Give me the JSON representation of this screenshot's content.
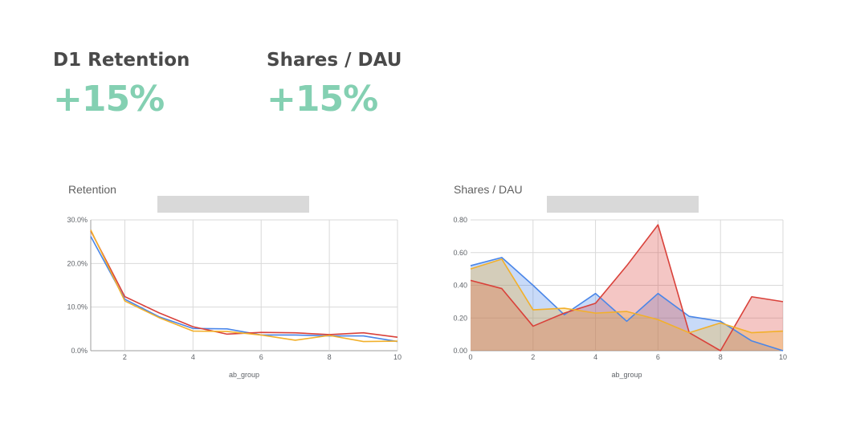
{
  "kpis": [
    {
      "label": "D1 Retention",
      "value": "+15%"
    },
    {
      "label": "Shares / DAU",
      "value": "+15%"
    }
  ],
  "colors": {
    "kpi_value": "#84d0b2",
    "blue": "#4a86e8",
    "red": "#d9413a",
    "yellow": "#f2b02b",
    "grid": "#d9d9d9",
    "legend_placeholder": "#d9d9d9"
  },
  "chart_data": [
    {
      "type": "line",
      "title": "Retention",
      "xlabel": "ab_group",
      "ylabel": "",
      "xlim": [
        1,
        10
      ],
      "ylim": [
        0,
        0.3
      ],
      "x_ticks": [
        "2",
        "4",
        "6",
        "8",
        "10"
      ],
      "x_tick_values": [
        2,
        4,
        6,
        8,
        10
      ],
      "y_ticks": [
        "0.0%",
        "10.0%",
        "20.0%",
        "30.0%"
      ],
      "y_tick_values": [
        0,
        0.1,
        0.2,
        0.3
      ],
      "grid": true,
      "x": [
        1,
        2,
        3,
        4,
        5,
        6,
        7,
        8,
        9,
        10
      ],
      "series": [
        {
          "color": "#4a86e8",
          "values": [
            0.262,
            0.118,
            0.078,
            0.051,
            0.05,
            0.036,
            0.036,
            0.034,
            0.034,
            0.021
          ]
        },
        {
          "color": "#d9413a",
          "values": [
            0.275,
            0.124,
            0.087,
            0.055,
            0.038,
            0.042,
            0.041,
            0.037,
            0.041,
            0.031
          ]
        },
        {
          "color": "#f2b02b",
          "values": [
            0.277,
            0.114,
            0.076,
            0.045,
            0.044,
            0.036,
            0.024,
            0.035,
            0.021,
            0.022
          ]
        }
      ]
    },
    {
      "type": "area",
      "title": "Shares / DAU",
      "xlabel": "ab_group",
      "ylabel": "",
      "xlim": [
        0,
        10
      ],
      "ylim": [
        0,
        0.8
      ],
      "x_ticks": [
        "0",
        "2",
        "4",
        "6",
        "8",
        "10"
      ],
      "x_tick_values": [
        0,
        2,
        4,
        6,
        8,
        10
      ],
      "y_ticks": [
        "0.00",
        "0.20",
        "0.40",
        "0.60",
        "0.80"
      ],
      "y_tick_values": [
        0,
        0.2,
        0.4,
        0.6,
        0.8
      ],
      "grid": true,
      "x": [
        0,
        1,
        2,
        3,
        4,
        5,
        6,
        7,
        8,
        9,
        10
      ],
      "series": [
        {
          "color": "#4a86e8",
          "values": [
            0.52,
            0.57,
            0.4,
            0.22,
            0.35,
            0.18,
            0.35,
            0.21,
            0.18,
            0.06,
            0.0
          ]
        },
        {
          "color": "#d9413a",
          "values": [
            0.43,
            0.38,
            0.15,
            0.23,
            0.29,
            0.52,
            0.77,
            0.11,
            0.0,
            0.33,
            0.3
          ]
        },
        {
          "color": "#f2b02b",
          "values": [
            0.5,
            0.56,
            0.25,
            0.26,
            0.23,
            0.24,
            0.19,
            0.11,
            0.17,
            0.11,
            0.12
          ]
        }
      ]
    }
  ]
}
